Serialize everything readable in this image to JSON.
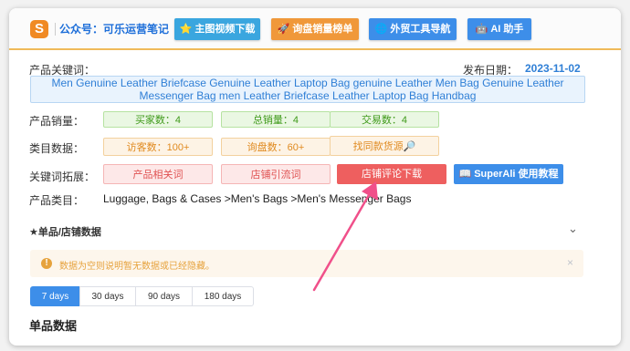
{
  "header": {
    "logo_letter": "S",
    "account": "公众号：可乐运营笔记",
    "buttons": [
      {
        "icon": "⭐",
        "label": "主图视频下载"
      },
      {
        "icon": "🚀",
        "label": "询盘销量榜单"
      },
      {
        "icon": "🌐",
        "label": "外贸工具导航"
      },
      {
        "icon": "🤖",
        "label": "AI 助手"
      }
    ]
  },
  "product": {
    "keyword_label": "产品关键词：",
    "keyword_value": "Men Genuine Leather Briefcase Genuine Leather Laptop Bag genuine Leather Men Bag Genuine Leather Messenger Bag men Leather Briefcase Leather Laptop Bag Handbag",
    "publish_label": "发布日期：",
    "publish_date": "2023-11-02",
    "sales_label": "产品销量：",
    "sales": [
      "买家数：4",
      "总销量：4",
      "交易数：4"
    ],
    "category_data_label": "类目数据：",
    "category_data": [
      "访客数：100+",
      "询盘数：60+",
      "找同款货源🔎"
    ],
    "expand_label": "关键词拓展：",
    "expand_buttons": [
      "产品相关词",
      "店铺引流词",
      "店铺评论下载"
    ],
    "superali_button": "📖 SuperAli 使用教程",
    "category_label": "产品类目：",
    "category_value": "Luggage, Bags & Cases >Men's Bags >Men's Messenger Bags"
  },
  "section": {
    "title": "★单品/店铺数据",
    "alert_icon": "!",
    "alert_text": "数据为空则说明暂无数据或已经隐藏。",
    "alert_close": "×",
    "day_tabs": [
      "7 days",
      "30 days",
      "90 days",
      "180 days"
    ],
    "active_tab": "7 days",
    "single_title": "单品数据"
  },
  "colors": {
    "header_accent": "#f0ba59",
    "blue_button": "#3d8ee9",
    "orange_button": "#f0983a",
    "red_button": "#ee5f5f",
    "arrow": "#f0508a"
  }
}
